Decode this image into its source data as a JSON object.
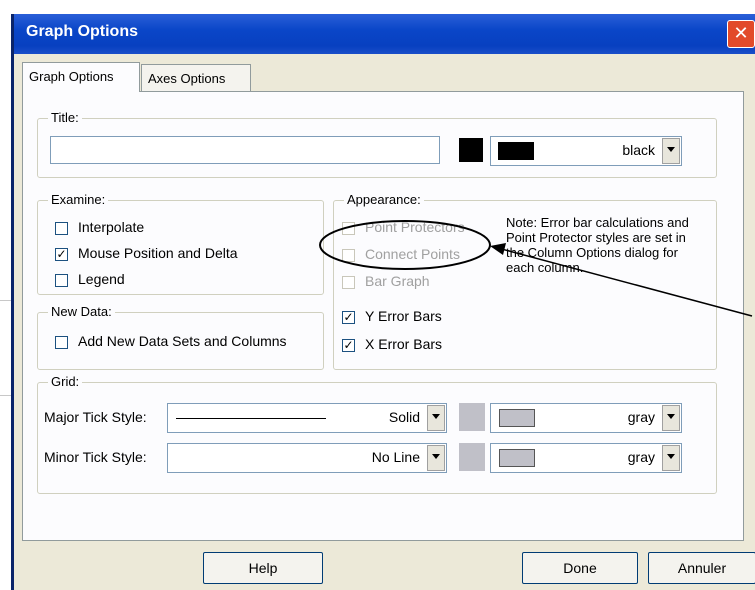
{
  "window": {
    "title": "Graph Options",
    "close_icon": "close-icon"
  },
  "tabs": [
    {
      "label": "Graph Options",
      "active": true
    },
    {
      "label": "Axes Options",
      "active": false
    }
  ],
  "title_group": {
    "legend": "Title:",
    "value": "",
    "color_label": "black",
    "color_hex": "#000000"
  },
  "examine": {
    "legend": "Examine:",
    "items": [
      {
        "label": "Interpolate",
        "checked": false
      },
      {
        "label": "Mouse Position and Delta",
        "checked": true
      },
      {
        "label": "Legend",
        "checked": false
      }
    ]
  },
  "new_data": {
    "legend": "New Data:",
    "items": [
      {
        "label": "Add New Data Sets and Columns",
        "checked": false
      }
    ]
  },
  "appearance": {
    "legend": "Appearance:",
    "items": [
      {
        "label": "Point Protectors",
        "checked": false,
        "disabled": true
      },
      {
        "label": "Connect Points",
        "checked": false,
        "disabled": true
      },
      {
        "label": "Bar Graph",
        "checked": false,
        "disabled": true
      },
      {
        "label": "Y Error Bars",
        "checked": true,
        "disabled": false
      },
      {
        "label": "X Error Bars",
        "checked": true,
        "disabled": false
      }
    ],
    "note": "Note:  Error bar calculations and Point Protector styles are set in the Column Options dialog for each column."
  },
  "grid": {
    "legend": "Grid:",
    "major": {
      "label": "Major Tick Style:",
      "style": "Solid",
      "color_label": "gray",
      "color_hex": "#c0c0c8"
    },
    "minor": {
      "label": "Minor Tick Style:",
      "style": "No Line",
      "color_label": "gray",
      "color_hex": "#c0c0c8"
    }
  },
  "buttons": {
    "help": "Help",
    "done": "Done",
    "cancel": "Annuler"
  }
}
